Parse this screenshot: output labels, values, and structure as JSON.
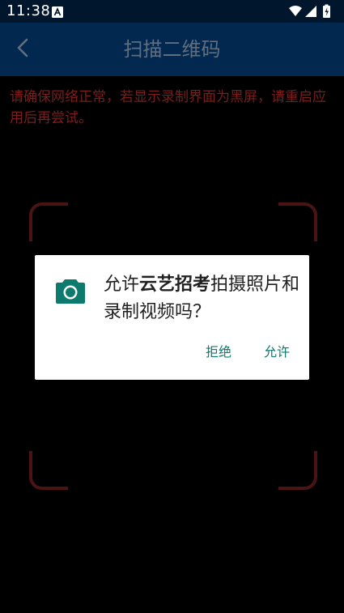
{
  "status_bar": {
    "time": "11:38",
    "icons": [
      "autofill-a-icon",
      "wifi-icon",
      "cell-signal-icon",
      "battery-charging-icon"
    ]
  },
  "app_bar": {
    "title": "扫描二维码",
    "back_icon": "chevron-left-icon"
  },
  "notice": {
    "text": "请确保网络正常，若显示录制界面为黑屏，请重启应用后再尝试。"
  },
  "dialog": {
    "icon": "camera-icon",
    "message_prefix": "允许",
    "app_name": "云艺招考",
    "message_suffix": "拍摄照片和录制视频吗？",
    "deny_label": "拒绝",
    "allow_label": "允许"
  },
  "colors": {
    "status_bar_bg": "#00162c",
    "app_bar_bg": "#032850",
    "title_text": "#5f6f7f",
    "notice_text": "#7a1d1d",
    "scan_frame": "#4a1414",
    "dialog_accent": "#0d7a6e",
    "screen_bg": "#000000"
  }
}
